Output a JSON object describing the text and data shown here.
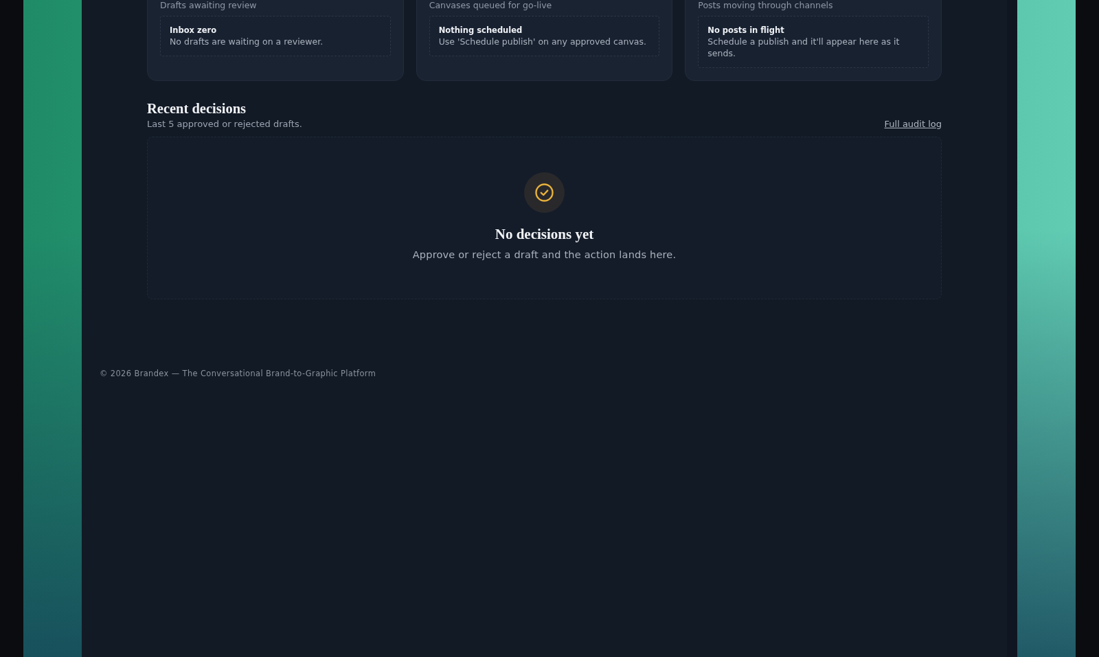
{
  "queue_cards": [
    {
      "subtitle": "Drafts awaiting review",
      "empty_title": "Inbox zero",
      "empty_text": "No drafts are waiting on a reviewer."
    },
    {
      "subtitle": "Canvases queued for go-live",
      "empty_title": "Nothing scheduled",
      "empty_text": "Use 'Schedule publish' on any approved canvas."
    },
    {
      "subtitle": "Posts moving through channels",
      "empty_title": "No posts in flight",
      "empty_text": "Schedule a publish and it'll appear here as it sends."
    }
  ],
  "recent_decisions": {
    "title": "Recent decisions",
    "subtitle": "Last 5 approved or rejected drafts.",
    "link": "Full audit log",
    "empty_state": {
      "title": "No decisions yet",
      "text": "Approve or reject a draft and the action lands here."
    }
  },
  "footer": {
    "text": "© 2026 Brandex — The Conversational Brand-to-Graphic Platform"
  }
}
